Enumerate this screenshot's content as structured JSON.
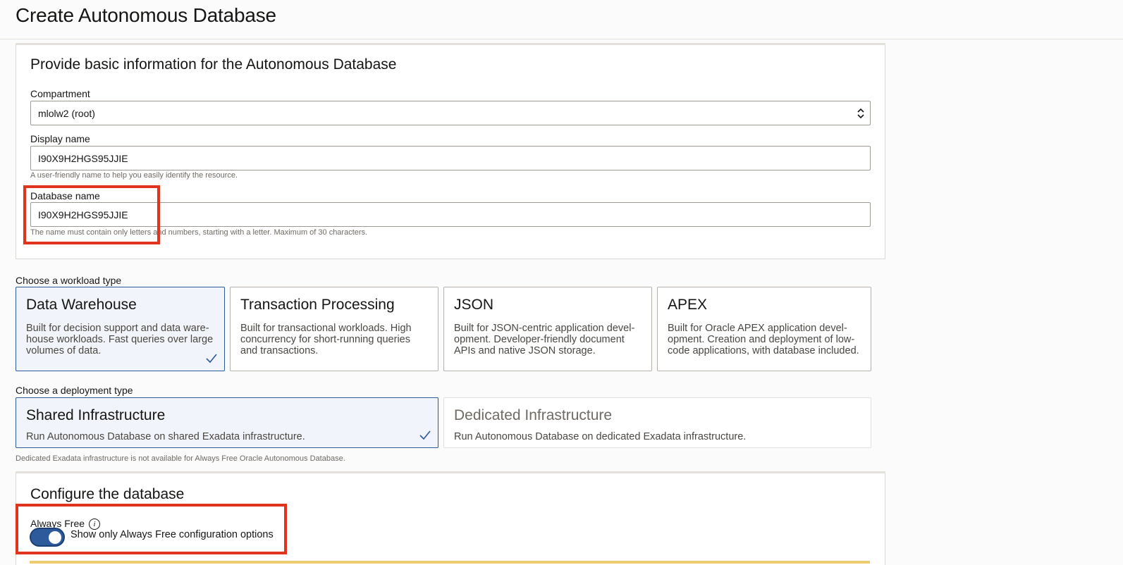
{
  "header": {
    "title": "Create Autonomous Database"
  },
  "basic": {
    "heading": "Provide basic information for the Autonomous Database",
    "compartment": {
      "label": "Compartment",
      "value": "mlolw2 (root)"
    },
    "display_name": {
      "label": "Display name",
      "value": "I90X9H2HGS95JJIE",
      "hint": "A user-friendly name to help you easily identify the resource."
    },
    "database_name": {
      "label": "Database name",
      "value": "I90X9H2HGS95JJIE",
      "hint": "The name must contain only letters and numbers, starting with a letter. Maximum of 30 characters."
    }
  },
  "workload": {
    "label": "Choose a workload type",
    "options": [
      {
        "title": "Data Warehouse",
        "desc": "Built for decision support and data ware-house workloads. Fast queries over large volumes of data.",
        "selected": true
      },
      {
        "title": "Transaction Processing",
        "desc": "Built for transactional workloads. High concurrency for short-running queries and transactions.",
        "selected": false
      },
      {
        "title": "JSON",
        "desc": "Built for JSON-centric application devel-opment. Developer-friendly document APIs and native JSON storage.",
        "selected": false
      },
      {
        "title": "APEX",
        "desc": "Built for Oracle APEX application devel-opment. Creation and deployment of low-code applications, with database included.",
        "selected": false
      }
    ]
  },
  "deployment": {
    "label": "Choose a deployment type",
    "options": [
      {
        "title": "Shared Infrastructure",
        "desc": "Run Autonomous Database on shared Exadata infrastructure.",
        "selected": true
      },
      {
        "title": "Dedicated Infrastructure",
        "desc": "Run Autonomous Database on dedicated Exadata infrastructure.",
        "selected": false,
        "disabled": true
      }
    ],
    "note": "Dedicated Exadata infrastructure is not available for Always Free Oracle Autonomous Database."
  },
  "config": {
    "heading": "Configure the database",
    "always_free": {
      "label": "Always Free",
      "info": "i",
      "toggle_label": "Show only Always Free configuration options",
      "enabled": true
    }
  },
  "colors": {
    "accent": "#2c5a9b",
    "highlight": "#e0341e"
  }
}
